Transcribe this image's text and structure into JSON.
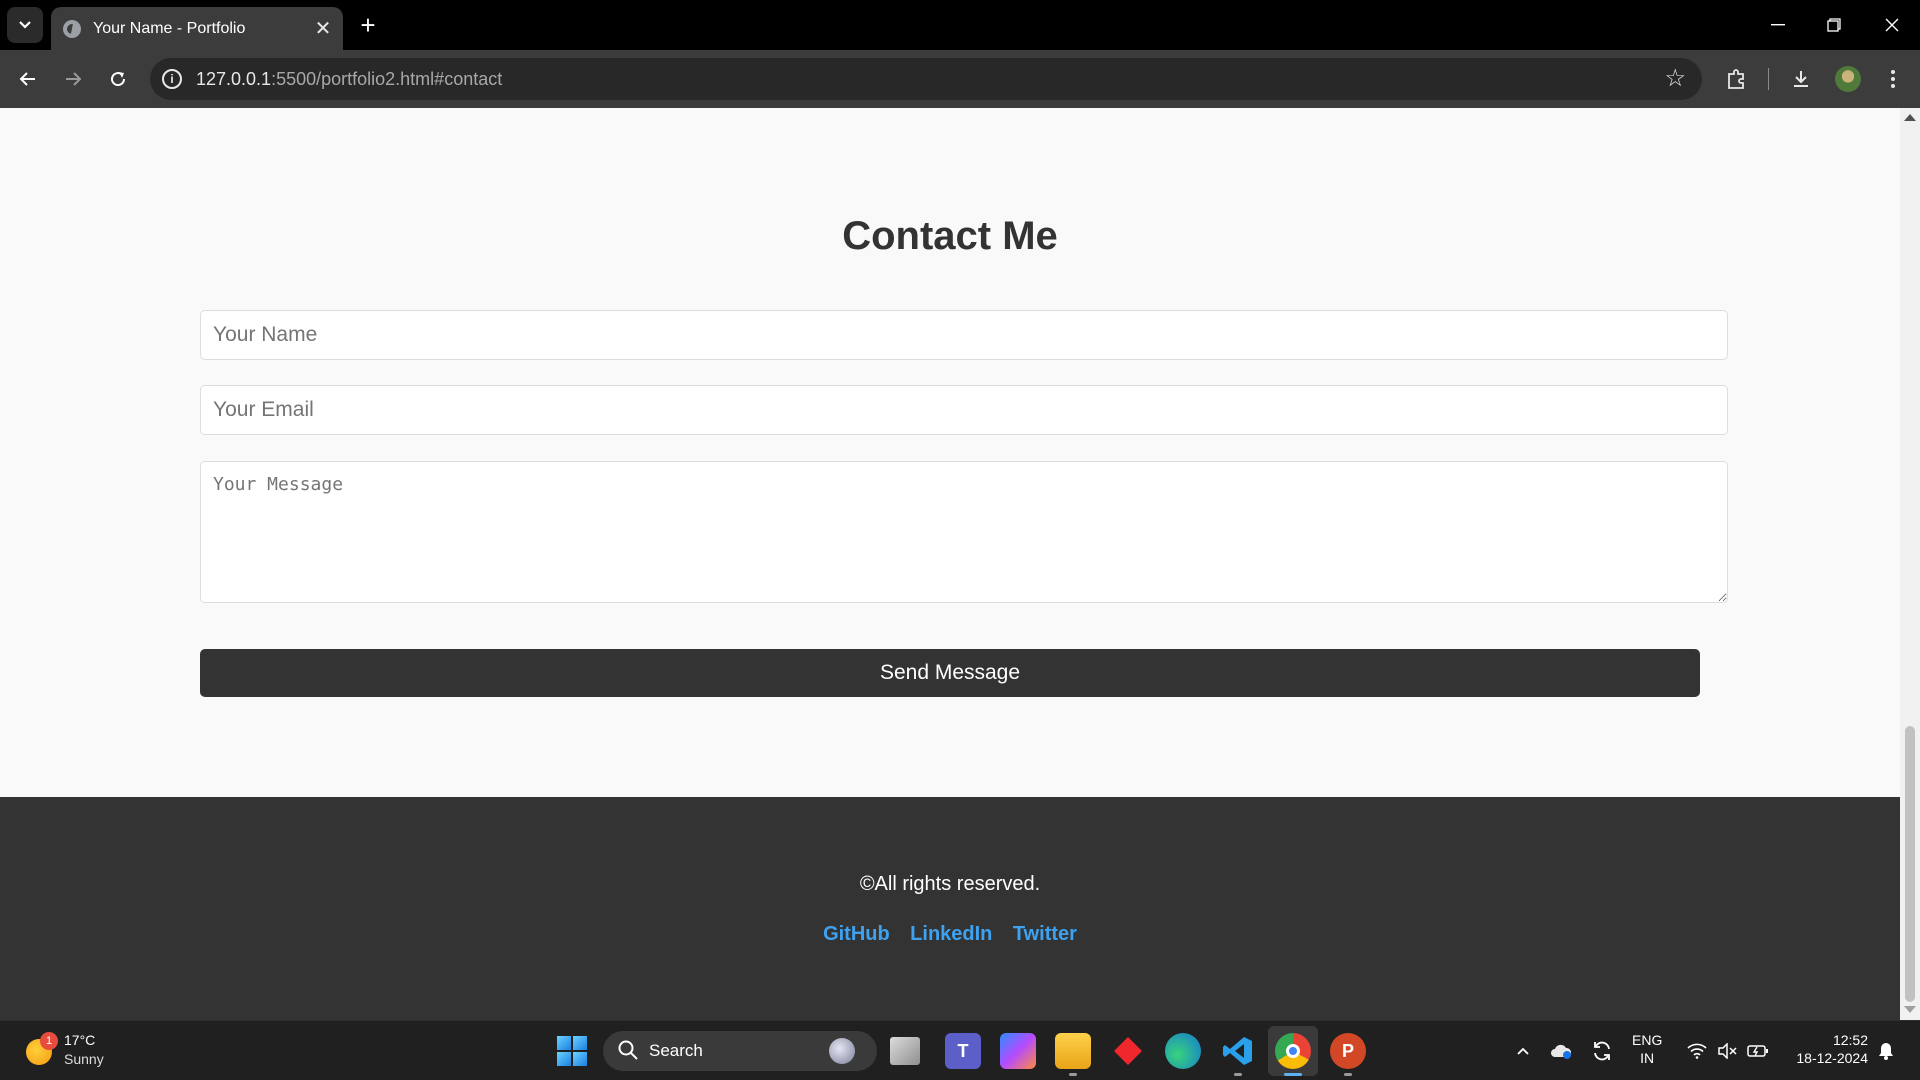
{
  "browser": {
    "tab_title": "Your Name - Portfolio",
    "tab_close": "✕",
    "new_tab": "+",
    "url_host": "127.0.0.1",
    "url_rest": ":5500/portfolio2.html#contact"
  },
  "page": {
    "section_title": "Contact Me",
    "name_placeholder": "Your Name",
    "email_placeholder": "Your Email",
    "message_placeholder": "Your Message",
    "submit_label": "Send Message"
  },
  "footer": {
    "copyright": "©All rights reserved.",
    "links": [
      "GitHub",
      "LinkedIn",
      "Twitter"
    ],
    "link_color": "#3ea2f0"
  },
  "taskbar": {
    "weather_badge": "1",
    "weather_temp": "17°C",
    "weather_condition": "Sunny",
    "search_label": "Search",
    "lang_line1": "ENG",
    "lang_line2": "IN",
    "time": "12:52",
    "date": "18-12-2024"
  },
  "colors": {
    "page_background": "#f9f9f9",
    "button_background": "#333333",
    "footer_background": "#333333"
  }
}
